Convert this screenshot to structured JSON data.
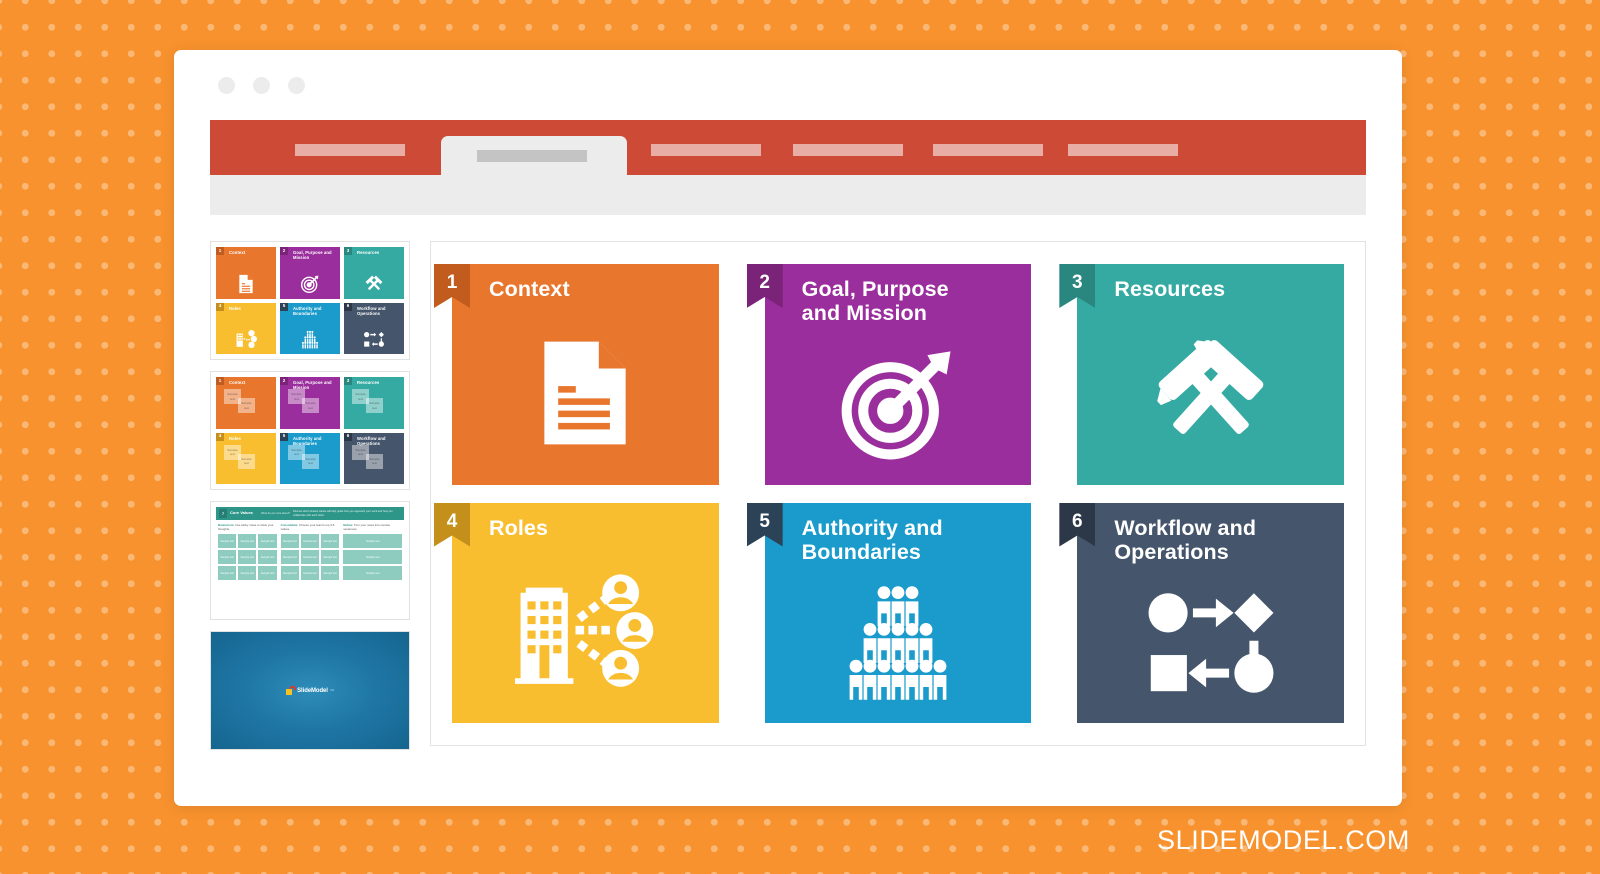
{
  "watermark": "SLIDEMODEL.COM",
  "background": {
    "color": "#F8922E",
    "dot_color": "#FBB160"
  },
  "browser": {
    "window_dots": [
      "dot-1",
      "dot-2",
      "dot-3"
    ],
    "ribbon": {
      "color": "#CC4A36",
      "active_tab_color": "#ECECEC",
      "placeholders": [
        "tab-placeholder-1",
        "tab-placeholder-3",
        "tab-placeholder-4",
        "tab-placeholder-5",
        "tab-placeholder-6"
      ],
      "active_tab_placeholder": "active-tab-label"
    }
  },
  "slide": {
    "cards": [
      {
        "number": "1",
        "title": "Context",
        "color": "#E8762C",
        "tag_color": "#C25C1E",
        "icon": "document-icon"
      },
      {
        "number": "2",
        "title": "Goal, Purpose\nand Mission",
        "color": "#9A2E9C",
        "tag_color": "#7A2379",
        "icon": "target-arrow-icon"
      },
      {
        "number": "3",
        "title": "Resources",
        "color": "#35AAA2",
        "tag_color": "#2A8780",
        "icon": "hammers-icon"
      },
      {
        "number": "4",
        "title": "Roles",
        "color": "#F9BE30",
        "tag_color": "#C4901B",
        "icon": "org-building-people-icon"
      },
      {
        "number": "5",
        "title": "Authority and\nBoundaries",
        "color": "#1A9BCB",
        "tag_color": "#2C4257",
        "icon": "people-pyramid-icon"
      },
      {
        "number": "6",
        "title": "Workflow and\nOperations",
        "color": "#45556B",
        "tag_color": "#2C3847",
        "icon": "flowchart-icon"
      }
    ]
  },
  "thumbnails": [
    {
      "name": "thumbnail-slide-1",
      "type": "six-cards",
      "selected": false
    },
    {
      "name": "thumbnail-slide-2",
      "type": "six-cards-with-notes",
      "note_text": "Sample text",
      "selected": false
    },
    {
      "name": "thumbnail-slide-3",
      "type": "core-values-worksheet",
      "number": "7",
      "title": "Core Values",
      "subtitle": "What do you care about?",
      "description": "Discuss which shared values will help guide how you approach your work and how you collaborate with each other.",
      "steps": [
        {
          "num": "1.",
          "label": "Brainstorm:",
          "text": "Use sticky notes to show your thoughts."
        },
        {
          "num": "2.",
          "label": "Consolidate:",
          "text": "Choose your team's top 3-5 values."
        },
        {
          "num": "3.",
          "label": "Refine:",
          "text": "Turn your notes into concise sentences."
        }
      ],
      "cell_text": "Sample text",
      "selected": false
    },
    {
      "name": "thumbnail-slide-4",
      "type": "logo-slide",
      "logo_text": "SlideModel",
      "logo_tm": "™",
      "selected": false
    }
  ]
}
